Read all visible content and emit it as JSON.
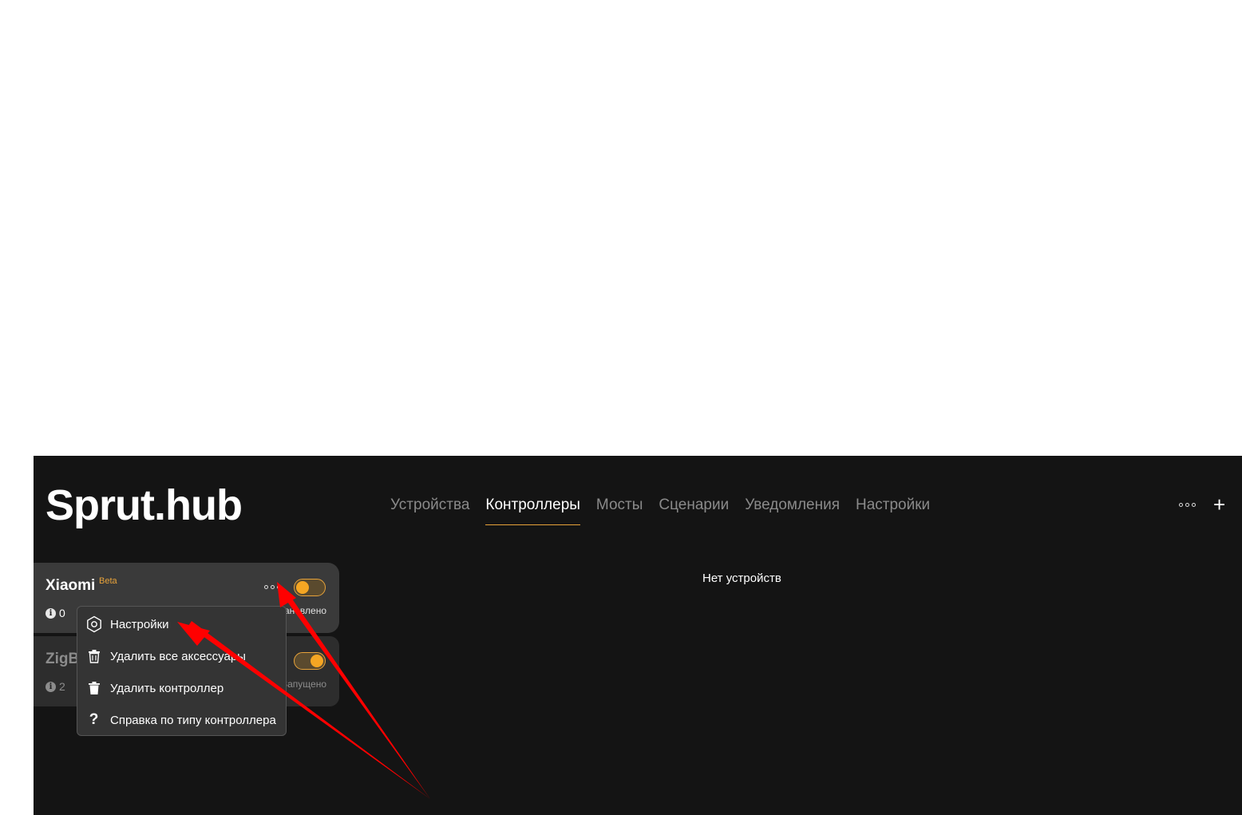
{
  "app": {
    "logo": "Sprut.hub"
  },
  "nav": [
    {
      "label": "Устройства"
    },
    {
      "label": "Контроллеры",
      "active": true
    },
    {
      "label": "Мосты"
    },
    {
      "label": "Сценарии"
    },
    {
      "label": "Уведомления"
    },
    {
      "label": "Настройки"
    }
  ],
  "header": {
    "more_icon": "more-dots-icon",
    "add_label": "+"
  },
  "controllers": [
    {
      "name": "Xiaomi",
      "badge": "Beta",
      "info_count": "0",
      "status": "Остановлено",
      "toggle_on": false
    },
    {
      "name": "ZigBee",
      "badge": "",
      "info_count": "2",
      "status": "Запущено",
      "toggle_on": true
    }
  ],
  "menu": {
    "items": [
      {
        "label": "Настройки",
        "icon": "gear-icon"
      },
      {
        "label": "Удалить все аксессуары",
        "icon": "trash-outline-icon"
      },
      {
        "label": "Удалить контроллер",
        "icon": "trash-filled-icon"
      },
      {
        "label": "Справка по типу контроллера",
        "icon": "question-icon"
      }
    ]
  },
  "main": {
    "empty_text": "Нет устройств"
  },
  "colors": {
    "accent": "#e8a33a",
    "background": "#141414",
    "card": "#3a3a3a",
    "annotation": "#ff0000"
  }
}
